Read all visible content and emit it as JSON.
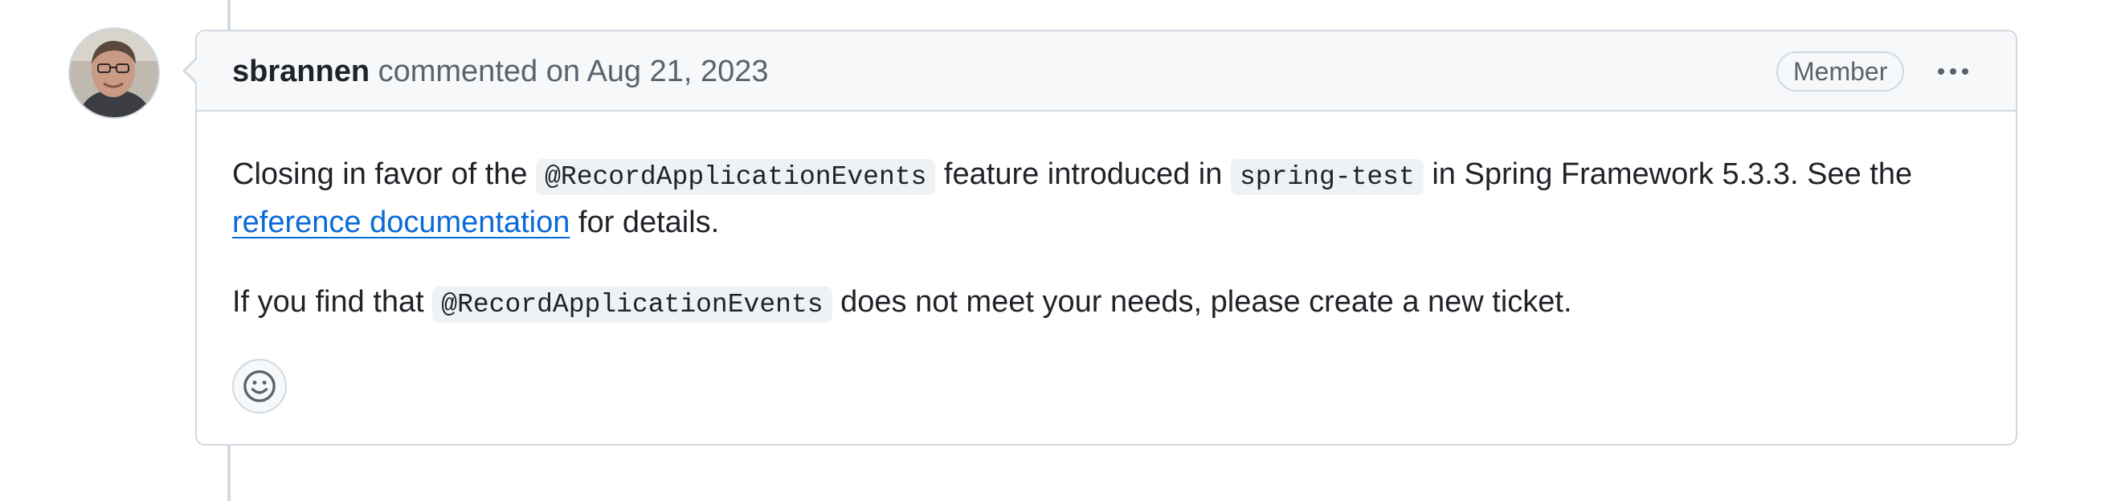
{
  "comment": {
    "author": "sbrannen",
    "action": "commented on",
    "date": "Aug 21, 2023",
    "badge": "Member",
    "menu_icon": "kebab-horizontal-icon",
    "avatar_icon": "user-avatar"
  },
  "body": {
    "p1_before_code1": "Closing in favor of the ",
    "code1": "@RecordApplicationEvents",
    "p1_between": " feature introduced in ",
    "code2": "spring-test",
    "p1_after_code2": " in Spring Framework 5.3.3. See the ",
    "link_text": "reference documentation",
    "p1_end": " for details.",
    "p2_before_code": "If you find that ",
    "code3": "@RecordApplicationEvents",
    "p2_after_code": " does not meet your needs, please create a new ticket."
  },
  "reactions": {
    "add_reaction_icon": "smiley-icon"
  },
  "colors": {
    "link": "#0969da",
    "border": "#d1d9e0",
    "header_bg": "#f6f8fa",
    "muted_text": "#59636e",
    "code_bg": "#eff2f5"
  }
}
